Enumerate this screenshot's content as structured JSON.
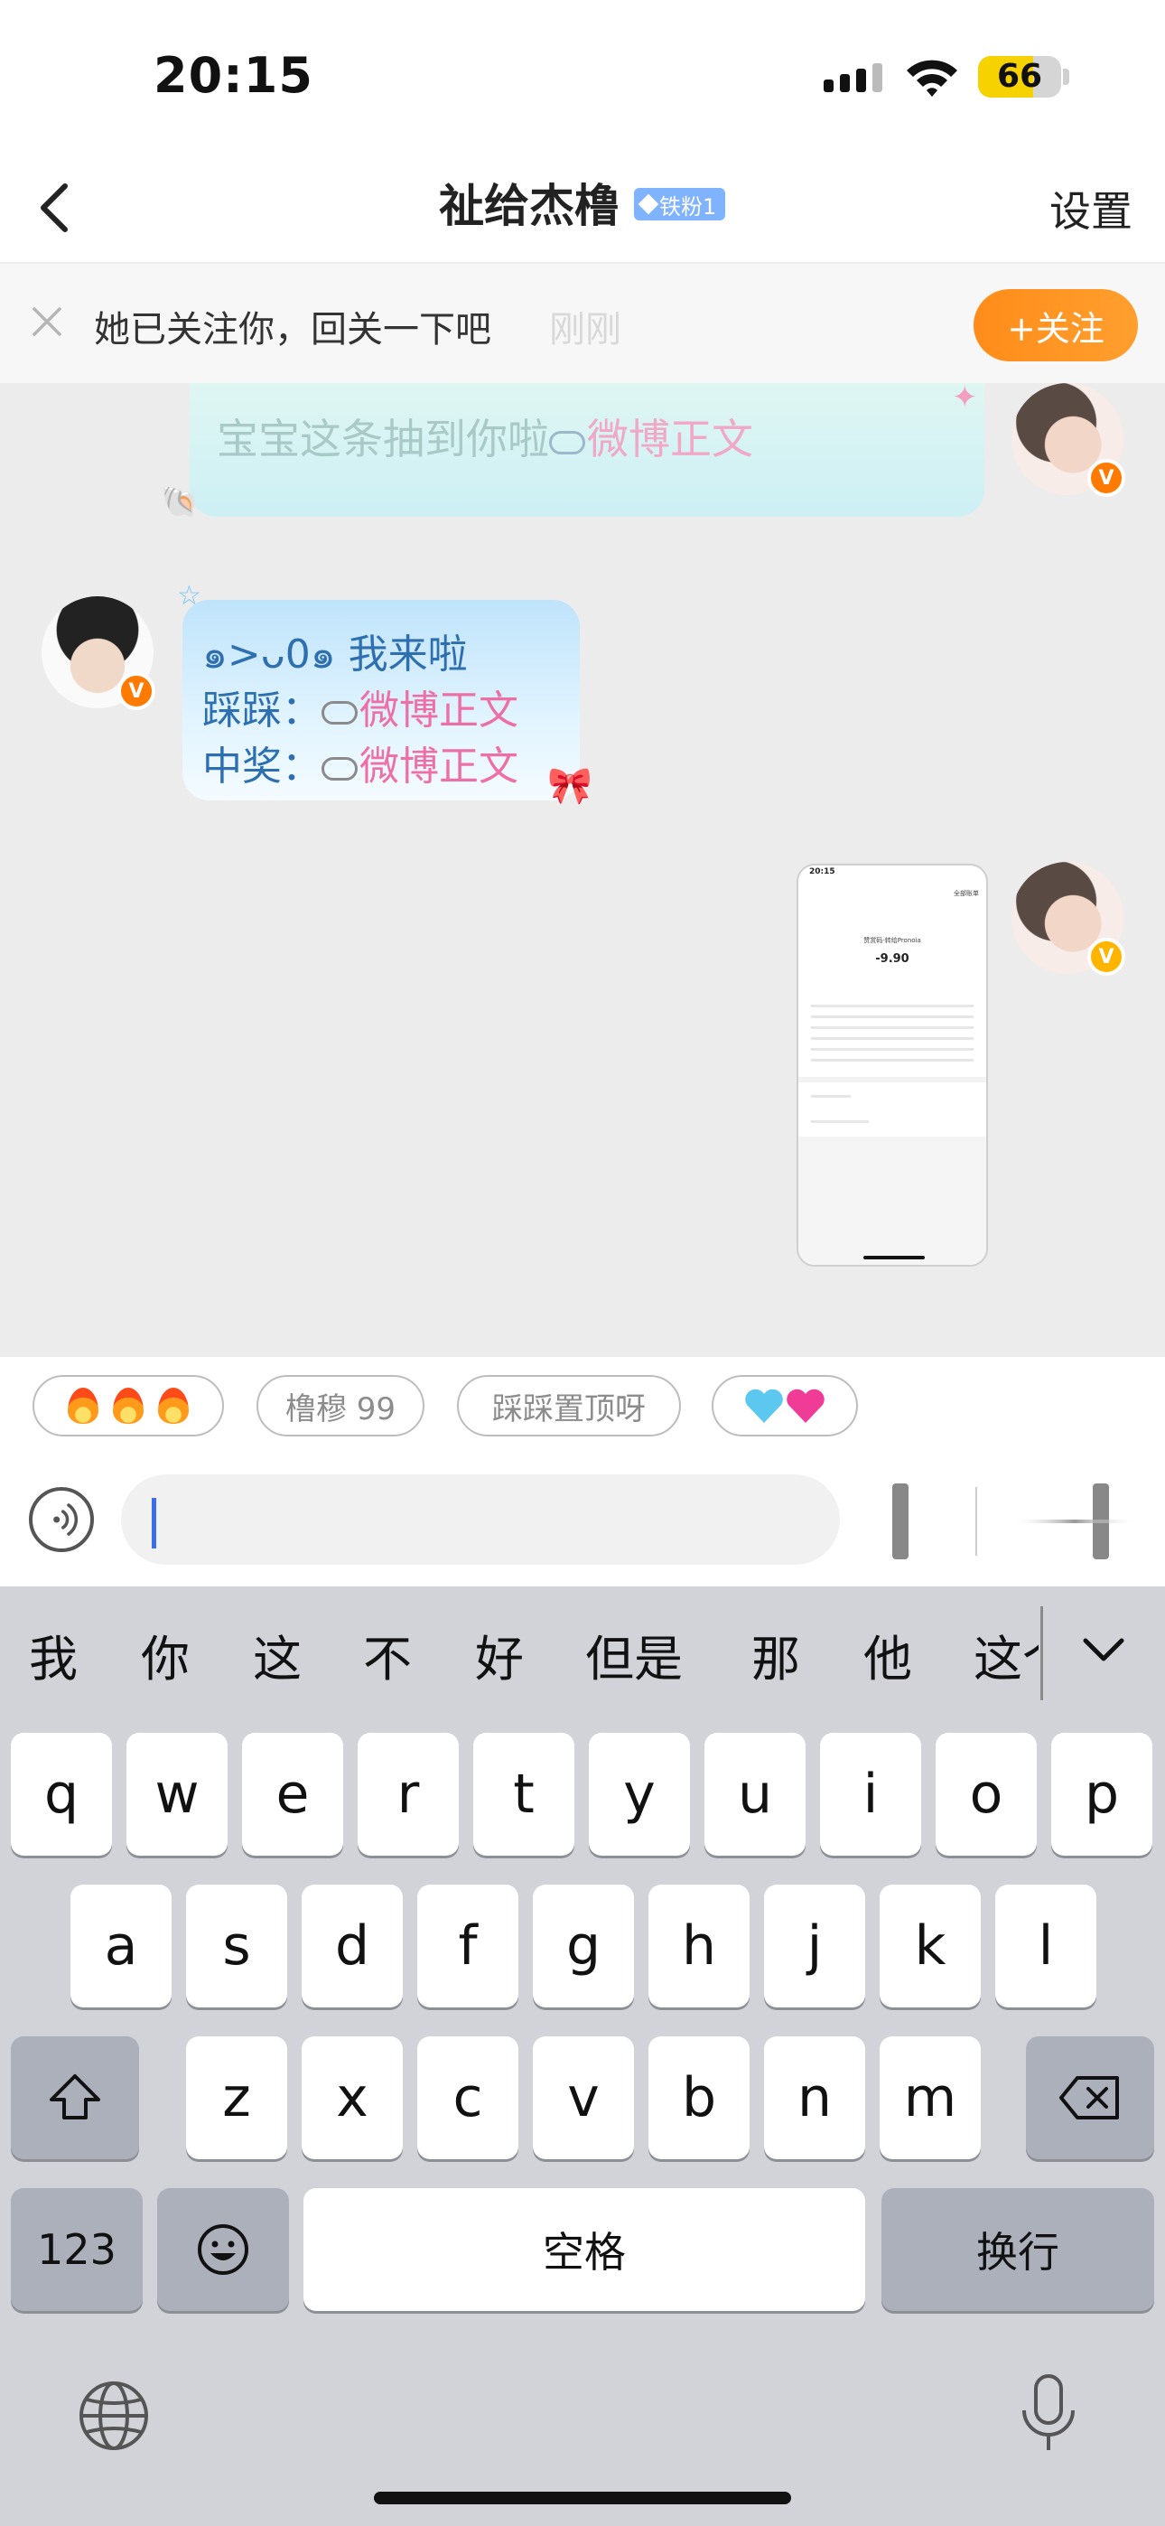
{
  "status_bar": {
    "time": "20:15",
    "battery": "66"
  },
  "nav": {
    "title": "祉给杰橹",
    "fan_badge": "铁粉1",
    "settings": "设置"
  },
  "follow_banner": {
    "text": "她已关注你，回关一下吧",
    "time": "刚刚",
    "button": "+关注"
  },
  "messages": {
    "top_bubble": {
      "text": "宝宝这条抽到你啦",
      "link": "微博正文"
    },
    "mid_bubble": {
      "line1": "๑>ᴗ0๑ 我来啦",
      "line2_label": "踩踩：",
      "line2_link": "微博正文",
      "line3_label": "中奖：",
      "line3_link": "微博正文"
    },
    "screenshot": {
      "time": "20:15",
      "header": "全部账单",
      "merchant": "赞赏码-转给Pronoia",
      "amount": "-9.90"
    }
  },
  "quick_replies": [
    {
      "label": "🔥🔥🔥",
      "icons": [
        "fire-icon",
        "fire-icon",
        "fire-icon"
      ]
    },
    {
      "label": "橹穆 99"
    },
    {
      "label": "踩踩置顶呀"
    },
    {
      "label": "💙💗",
      "icons": [
        "blue-heart-icon",
        "pink-heart-icon"
      ]
    }
  ],
  "input": {
    "value": "",
    "placeholder": ""
  },
  "keyboard": {
    "candidates": [
      "我",
      "你",
      "这",
      "不",
      "好",
      "但是",
      "那",
      "他",
      "这个"
    ],
    "row1": [
      "q",
      "w",
      "e",
      "r",
      "t",
      "y",
      "u",
      "i",
      "o",
      "p"
    ],
    "row2": [
      "a",
      "s",
      "d",
      "f",
      "g",
      "h",
      "j",
      "k",
      "l"
    ],
    "row3": [
      "z",
      "x",
      "c",
      "v",
      "b",
      "n",
      "m"
    ],
    "numbers_key": "123",
    "space_key": "空格",
    "return_key": "换行"
  },
  "colors": {
    "follow_orange": "#ff8c1a",
    "link_pink": "#ee6fa6",
    "caret_blue": "#3a6df0",
    "keyboard_bg": "#d1d3d9"
  }
}
